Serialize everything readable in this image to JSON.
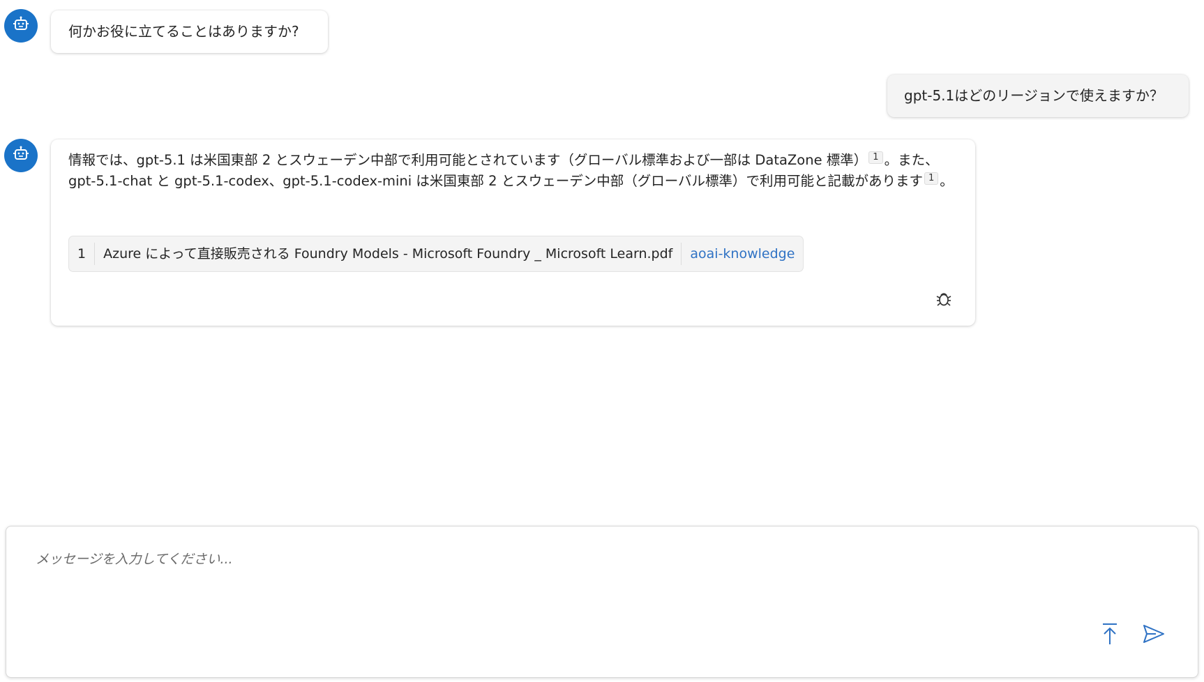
{
  "colors": {
    "accent": "#1a73c8",
    "link": "#2f72c4"
  },
  "messages": [
    {
      "role": "assistant",
      "text": "何かお役に立てることはありますか?"
    },
    {
      "role": "user",
      "text": "gpt-5.1はどのリージョンで使えますか？"
    },
    {
      "role": "assistant",
      "text_part1": "情報では、gpt-5.1 は米国東部 2 とスウェーデン中部で利用可能とされています（グローバル標準および一部は DataZone 標準）",
      "cite1": "1",
      "text_part2": "。また、gpt-5.1-chat と gpt-5.1-codex、gpt-5.1-codex-mini は米国東部 2 とスウェーデン中部（グローバル標準）で利用可能と記載があります",
      "cite2": "1",
      "text_part3": "。",
      "citation": {
        "number": "1",
        "title": "Azure によって直接販売される Foundry Models - Microsoft Foundry _ Microsoft Learn.pdf",
        "source": "aoai-knowledge"
      },
      "debug_icon": "bug-icon"
    }
  ],
  "composer": {
    "placeholder": "メッセージを入力してください...",
    "scroll_top_icon": "arrow-up-to-top-icon",
    "send_icon": "send-icon"
  },
  "assistant_avatar_icon": "bot-icon"
}
